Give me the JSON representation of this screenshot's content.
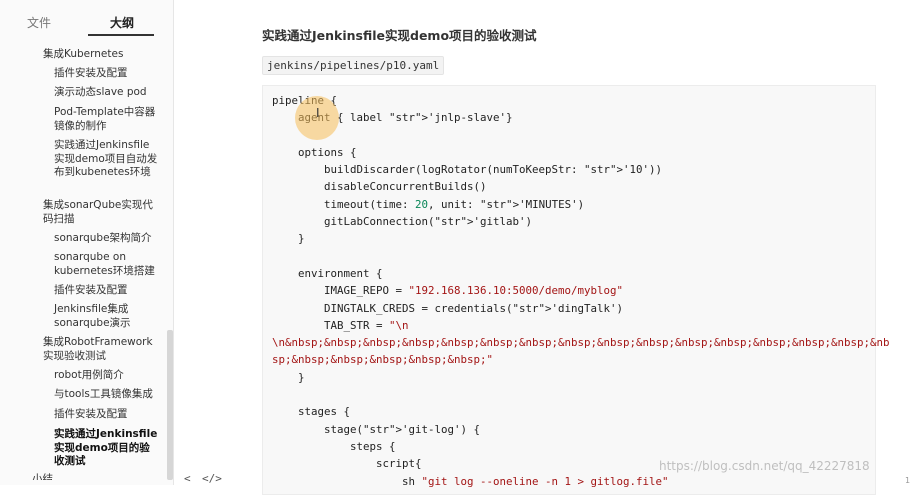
{
  "tabs": {
    "files": "文件",
    "outline": "大纲"
  },
  "outline": [
    {
      "label": "集成Kubernetes",
      "level": 2
    },
    {
      "label": "插件安装及配置",
      "level": 3
    },
    {
      "label": "演示动态slave pod",
      "level": 3
    },
    {
      "label": "Pod-Template中容器镜像的制作",
      "level": 3
    },
    {
      "label": "实践通过Jenkinsfile实现demo项目自动发布到kubenetes环境",
      "level": 3
    },
    {
      "label": "集成sonarQube实现代码扫描",
      "level": 2
    },
    {
      "label": "sonarqube架构简介",
      "level": 3
    },
    {
      "label": "sonarqube on kubernetes环境搭建",
      "level": 3
    },
    {
      "label": "插件安装及配置",
      "level": 3
    },
    {
      "label": "Jenkinsfile集成sonarqube演示",
      "level": 3
    },
    {
      "label": "集成RobotFramework实现验收测试",
      "level": 2
    },
    {
      "label": "robot用例简介",
      "level": 3
    },
    {
      "label": "与tools工具镜像集成",
      "level": 3
    },
    {
      "label": "插件安装及配置",
      "level": 3
    },
    {
      "label": "实践通过Jenkinsfile实现demo项目的验收测试",
      "level": 3,
      "active": true
    },
    {
      "label": "小结",
      "level": 1
    }
  ],
  "main": {
    "heading": "实践通过Jenkinsfile实现demo项目的验收测试",
    "file_path": "jenkins/pipelines/p10.yaml"
  },
  "code_lines": [
    "pipeline {",
    "    agent { label 'jnlp-slave'}",
    "",
    "    options {",
    "        buildDiscarder(logRotator(numToKeepStr: '10'))",
    "        disableConcurrentBuilds()",
    "        timeout(time: 20, unit: 'MINUTES')",
    "        gitLabConnection('gitlab')",
    "    }",
    "",
    "    environment {",
    "        IMAGE_REPO = \"192.168.136.10:5000/demo/myblog\"",
    "        DINGTALK_CREDS = credentials('dingTalk')",
    "        TAB_STR = \"\\n",
    "\\n&nbsp;&nbsp;&nbsp;&nbsp;&nbsp;&nbsp;&nbsp;&nbsp;&nbsp;&nbsp;&nbsp;&nbsp;&nbsp;&nbsp;&nbsp;&nb",
    "sp;&nbsp;&nbsp;&nbsp;&nbsp;&nbsp;\"",
    "    }",
    "",
    "    stages {",
    "        stage('git-log') {",
    "            steps {",
    "                script{",
    "                    sh \"git log --oneline -n 1 > gitlog.file\""
  ],
  "watermark": "https://blog.csdn.net/qq_42227818",
  "bottom_icons": [
    "chevron-left-icon",
    "code-icon"
  ],
  "bottom_glyphs": {
    "back": "<",
    "source": "</>"
  },
  "edge_number": "1",
  "colors": {
    "string": "#a31515",
    "number": "#098658",
    "cursor_highlight": "#f5be5a"
  }
}
